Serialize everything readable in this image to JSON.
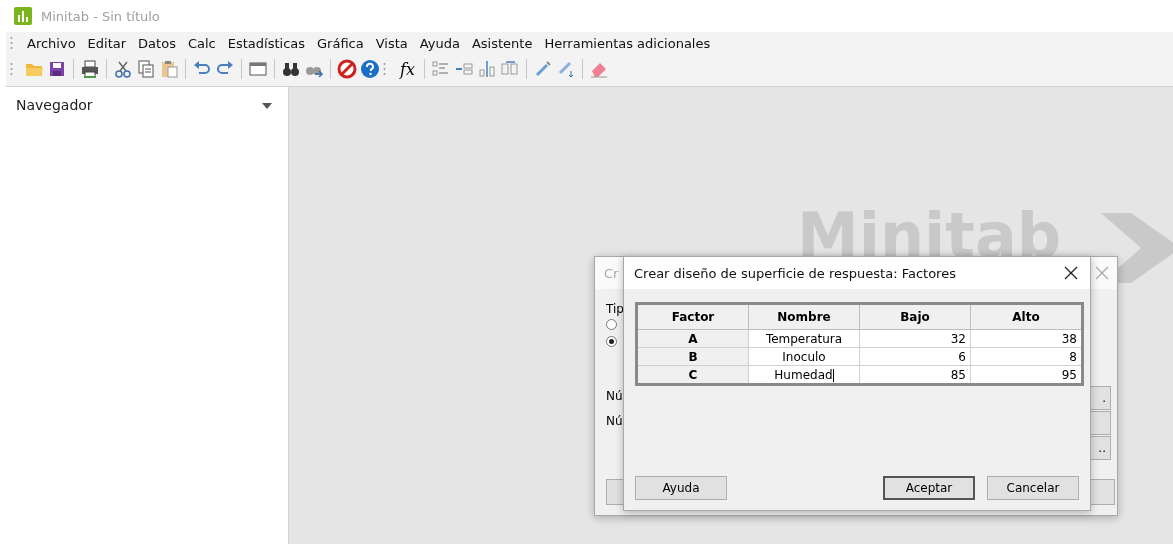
{
  "window": {
    "title": "Minitab - Sin título"
  },
  "menu": [
    "Archivo",
    "Editar",
    "Datos",
    "Calc",
    "Estadísticas",
    "Gráfica",
    "Vista",
    "Ayuda",
    "Asistente",
    "Herramientas adicionales"
  ],
  "toolbar": {
    "formula_label": "fx"
  },
  "navigator": {
    "title": "Navegador"
  },
  "workspace": {
    "logo_text": "Minitab"
  },
  "back_dialog": {
    "title": "Cr",
    "label": "Tip",
    "radios": [
      {
        "selected": false
      },
      {
        "selected": true
      }
    ],
    "fields": [
      "Nú",
      "Nú"
    ],
    "side_buttons": [
      ".",
      ".."
    ]
  },
  "dialog": {
    "title": "Crear diseño de superficie de respuesta: Factores",
    "table": {
      "columns": [
        "Factor",
        "Nombre",
        "Bajo",
        "Alto"
      ],
      "rows": [
        {
          "factor": "A",
          "name": "Temperatura",
          "low": "32",
          "high": "38",
          "editing": false
        },
        {
          "factor": "B",
          "name": "Inoculo",
          "low": "6",
          "high": "8",
          "editing": false
        },
        {
          "factor": "C",
          "name": "Humedad",
          "low": "85",
          "high": "95",
          "editing": true
        }
      ]
    },
    "buttons": [
      {
        "label": "Ayuda",
        "default": false
      },
      {
        "label": "Aceptar",
        "default": true
      },
      {
        "label": "Cancelar",
        "default": false
      }
    ]
  }
}
